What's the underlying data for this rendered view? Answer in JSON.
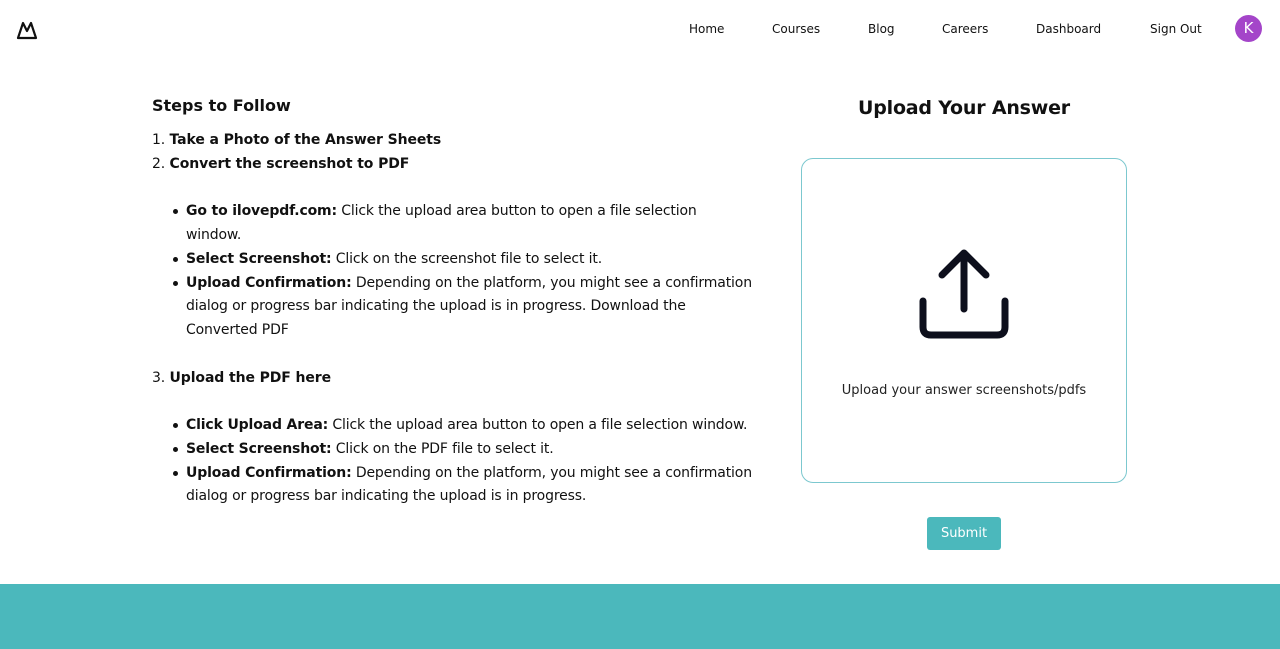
{
  "nav": {
    "items": [
      {
        "label": "Home"
      },
      {
        "label": "Courses"
      },
      {
        "label": "Blog"
      },
      {
        "label": "Careers"
      },
      {
        "label": "Dashboard"
      },
      {
        "label": "Sign Out"
      }
    ],
    "avatar_initial": "K",
    "avatar_color": "#a445c9"
  },
  "steps": {
    "title": "Steps to Follow",
    "step1": {
      "num": "1.",
      "text": "Take a Photo of the Answer Sheets"
    },
    "step2": {
      "num": "2.",
      "text": "Convert the screenshot to PDF"
    },
    "step2_items": [
      {
        "strong": "Go to ilovepdf.com:",
        "text": " Click the upload area button to open a file selection window."
      },
      {
        "strong": "Select Screenshot:",
        "text": " Click on the screenshot file to select it."
      },
      {
        "strong": "Upload Confirmation:",
        "text": " Depending on the platform, you might see a confirmation dialog or progress bar indicating the upload is in progress. Download the Converted PDF"
      }
    ],
    "step3": {
      "num": "3.",
      "text": "Upload the PDF here"
    },
    "step3_items": [
      {
        "strong": "Click Upload Area:",
        "text": " Click the upload area button to open a file selection window."
      },
      {
        "strong": "Select Screenshot:",
        "text": " Click on the PDF file to select it."
      },
      {
        "strong": "Upload Confirmation:",
        "text": " Depending on the platform, you might see a confirmation dialog or progress bar indicating the upload is in progress."
      }
    ]
  },
  "upload": {
    "title": "Upload Your Answer",
    "hint": "Upload your answer screenshots/pdfs",
    "icon": "upload-icon"
  },
  "submit_label": "Submit",
  "colors": {
    "accent": "#4bb8bc",
    "upload_border": "#7cc8cf"
  }
}
